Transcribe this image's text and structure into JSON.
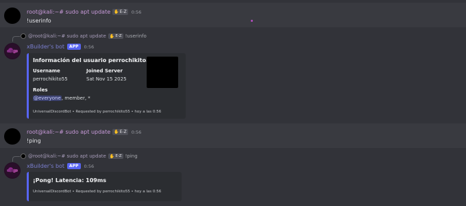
{
  "messages": [
    {
      "user": "root@kali:~# sudo apt update",
      "badge": "E-Z",
      "time": "0:56",
      "text": "!userinfo"
    },
    {
      "reply": {
        "user": "@root@kali:~# sudo apt update",
        "badge": "E-Z",
        "text": "!userinfo"
      },
      "bot": "xBuilder's bot",
      "app_tag": "APP",
      "time": "0:56",
      "embed": {
        "title": "Información del usuario perrochikito55",
        "field1_label": "Username",
        "field1_value": "perrochikito55",
        "field2_label": "Joined Server",
        "field2_value": "Sat Nov 15 2025",
        "roles_label": "Roles",
        "roles_mention": "@everyone",
        "roles_rest": ", member, *",
        "footer": "UniversalDiscordBot • Requested by perrochikito55 • hoy a las 0:56"
      }
    },
    {
      "user": "root@kali:~# sudo apt update",
      "badge": "E-Z",
      "time": "0:56",
      "text": "!ping"
    },
    {
      "reply": {
        "user": "@root@kali:~# sudo apt update",
        "badge": "E-Z",
        "text": "!ping"
      },
      "bot": "xBuilder's bot",
      "app_tag": "APP",
      "time": "0:56",
      "embed": {
        "title": "¡Pong! Latencia: 109ms",
        "footer": "UniversalDiscordBot • Requested by perrochikito55 • hoy a las 0:56"
      }
    }
  ],
  "colors": {
    "background": "#323339",
    "embed_accent": "#5865f2",
    "username": "#c89ad9"
  }
}
